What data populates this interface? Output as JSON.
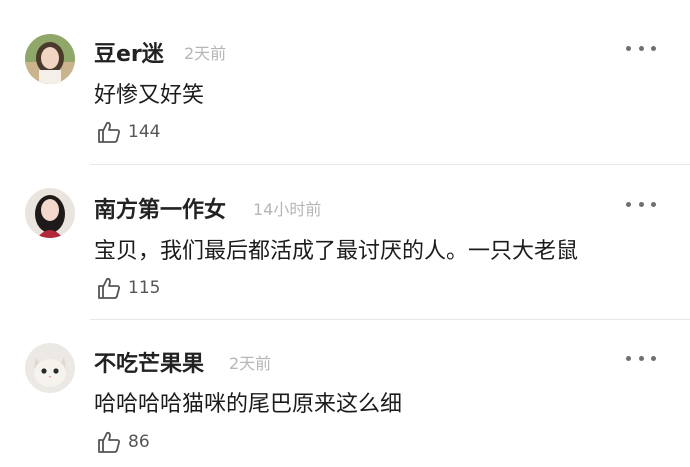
{
  "comments": [
    {
      "username": "豆er迷",
      "time": "2天前",
      "text": "好惨又好笑",
      "likes": "144",
      "avatar_icon": "avatar-girl-green"
    },
    {
      "username": "南方第一作女",
      "time": "14小时前",
      "text": "宝贝，我们最后都活成了最讨厌的人。一只大老鼠",
      "likes": "115",
      "avatar_icon": "avatar-girl-red"
    },
    {
      "username": "不吃芒果果",
      "time": "2天前",
      "text": "哈哈哈哈猫咪的尾巴原来这么细",
      "likes": "86",
      "avatar_icon": "avatar-cat"
    }
  ],
  "icons": {
    "more": "more-icon",
    "like": "thumbs-up-icon"
  }
}
